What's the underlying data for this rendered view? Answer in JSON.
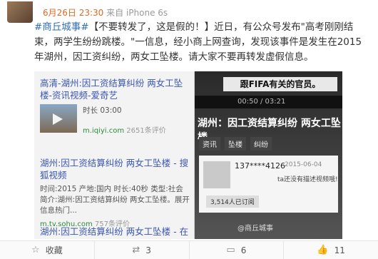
{
  "meta": {
    "date": "6月26日 23:30",
    "source": "来自 iPhone 6s"
  },
  "post": {
    "tag": "#商丘城事#",
    "quote": "【不要转发了，这是假的！】",
    "body": "近日，有公众号发布\"高考刚刚结束，两学生纷纷跳楼。\"一信息，经小商上网查询，发现该事件是发生在2015年湖州，因工资纠纷，两女工坠楼。请大家不要再转发虚假信息。"
  },
  "photo": {
    "card1": {
      "title": "高清-湖州:因工资结算纠纷 两女工坠楼-资讯视频-爱奇艺",
      "duration": "时长 03:00",
      "url": "m.iqiyi.com",
      "size": "2651条评价"
    },
    "card2": {
      "title": "湖州:因工资结算纠纷 两女工坠楼 - 搜狐视频",
      "desc": "时间:2015 产地:国内 时长:40秒 类型:社会 简介:湖州:因工资结算纠纷 两女工坠楼。展开信息热门...",
      "url": "m.tv.sohu.com",
      "size": "757条评价"
    },
    "card3": {
      "title": "湖州:因工资结算纠纷 两女工坠楼 - 在线观"
    },
    "banner": "跟FIFA有关的官员。",
    "player_time": "00:50 / 03:21",
    "video_title": "湖州：因工资结算纠纷 两女工坠楼",
    "buttons": [
      "资讯",
      "坠楼",
      "纠纷"
    ],
    "user_id": "137****4126",
    "user_date": "2015-06-04",
    "user_note": "ta还没有描述视频哦!",
    "views": "3,514人已订阅",
    "watermark": "@商丘城事"
  },
  "footer": {
    "save": "收藏",
    "repost": "3",
    "comment": "6",
    "like": "11"
  }
}
